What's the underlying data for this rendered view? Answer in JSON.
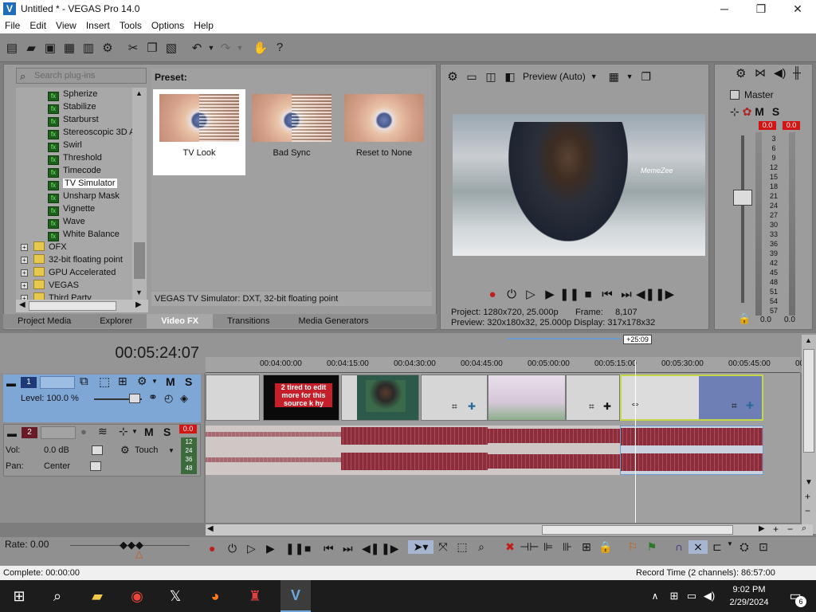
{
  "window": {
    "title": "Untitled * - VEGAS Pro 14.0",
    "minimize": "─",
    "maximize": "❐",
    "close": "✕",
    "logo": "V"
  },
  "menu": [
    "File",
    "Edit",
    "View",
    "Insert",
    "Tools",
    "Options",
    "Help"
  ],
  "plugins": {
    "search_placeholder": "Search plug-ins",
    "items": [
      {
        "label": "Spherize",
        "kind": "fx"
      },
      {
        "label": "Stabilize",
        "kind": "fx"
      },
      {
        "label": "Starburst",
        "kind": "fx"
      },
      {
        "label": "Stereoscopic 3D A",
        "kind": "fx"
      },
      {
        "label": "Swirl",
        "kind": "fx"
      },
      {
        "label": "Threshold",
        "kind": "fx"
      },
      {
        "label": "Timecode",
        "kind": "fx"
      },
      {
        "label": "TV Simulator",
        "kind": "fx",
        "selected": true
      },
      {
        "label": "Unsharp Mask",
        "kind": "fx"
      },
      {
        "label": "Vignette",
        "kind": "fx"
      },
      {
        "label": "Wave",
        "kind": "fx"
      },
      {
        "label": "White Balance",
        "kind": "fx"
      },
      {
        "label": "OFX",
        "kind": "folder"
      },
      {
        "label": "32-bit floating point",
        "kind": "folder"
      },
      {
        "label": "GPU Accelerated",
        "kind": "folder"
      },
      {
        "label": "VEGAS",
        "kind": "folder"
      },
      {
        "label": "Third Party",
        "kind": "folder"
      }
    ],
    "preset_label": "Preset:",
    "presets": [
      {
        "label": "TV Look",
        "selected": true
      },
      {
        "label": "Bad Sync",
        "selected": false
      },
      {
        "label": "Reset to None",
        "selected": false
      }
    ],
    "status": "VEGAS TV Simulator: DXT, 32-bit floating point"
  },
  "tabs": [
    {
      "label": "Project Media",
      "active": false
    },
    {
      "label": "Explorer",
      "active": false
    },
    {
      "label": "Video FX",
      "active": true
    },
    {
      "label": "Transitions",
      "active": false
    },
    {
      "label": "Media Generators",
      "active": false
    }
  ],
  "preview": {
    "mode": "Preview (Auto)",
    "watermark": "MemeZee",
    "project_label": "Project:",
    "project_value": "1280x720, 25.000p",
    "frame_label": "Frame:",
    "frame_value": "8,107",
    "preview_label": "Preview:",
    "preview_value": "320x180x32, 25.000p",
    "display_label": "Display:",
    "display_value": "317x178x32"
  },
  "mixer": {
    "master_label": "Master",
    "m": "M",
    "s": "S",
    "peak_left": "0.0",
    "peak_right": "0.0",
    "scale": [
      "3",
      "6",
      "9",
      "12",
      "15",
      "18",
      "21",
      "24",
      "27",
      "30",
      "33",
      "36",
      "39",
      "42",
      "45",
      "48",
      "51",
      "54",
      "57"
    ],
    "bottom_left": "0.0",
    "bottom_right": "0.0"
  },
  "timeline": {
    "timecode": "00:05:24:07",
    "cursor_badge": "+25:09",
    "ruler": [
      "00:04:00:00",
      "00:04:15:00",
      "00:04:30:00",
      "00:04:45:00",
      "00:05:00:00",
      "00:05:15:00",
      "00:05:30:00",
      "00:05:45:00",
      "00"
    ],
    "video_track": {
      "number": "1",
      "m": "M",
      "s": "S",
      "level": "Level: 100.0 %"
    },
    "audio_track": {
      "number": "2",
      "m": "M",
      "s": "S",
      "peak": "0.0",
      "vol_label": "Vol:",
      "vol_value": "0.0 dB",
      "pan_label": "Pan:",
      "pan_value": "Center",
      "touch": "Touch",
      "scale": [
        "12",
        "24",
        "36",
        "48"
      ]
    },
    "clip_text": "2 tired to edit more for this source k hy"
  },
  "bottom": {
    "rate": "Rate: 0.00"
  },
  "status": {
    "left": "Complete: 00:00:00",
    "right": "Record Time (2 channels): 86:57:00"
  },
  "taskbar": {
    "time": "9:02 PM",
    "date": "2/29/2024",
    "notifications": "6"
  }
}
